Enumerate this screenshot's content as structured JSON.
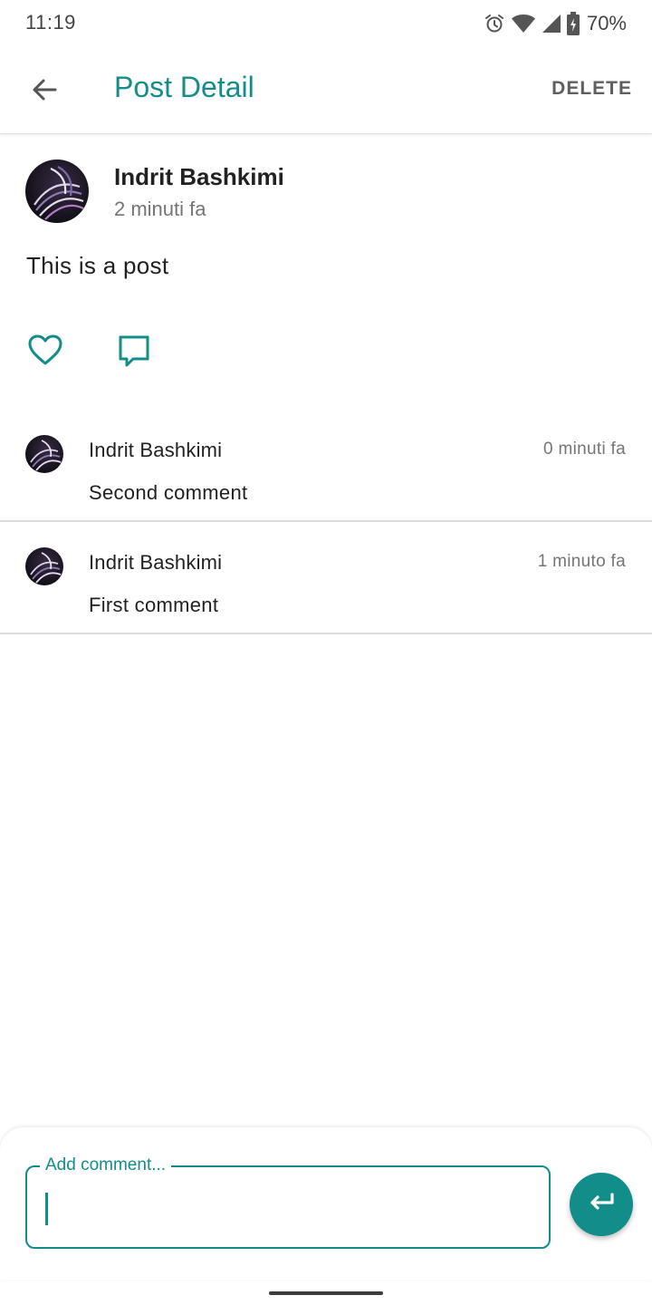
{
  "status_bar": {
    "time": "11:19",
    "battery_percent": "70%",
    "icons": [
      "alarm-icon",
      "wifi-icon",
      "signal-icon",
      "battery-charging-icon"
    ]
  },
  "app_bar": {
    "title": "Post Detail",
    "delete_label": "DELETE",
    "back_icon": "arrow-back-icon"
  },
  "post": {
    "author": "Indrit Bashkimi",
    "time": "2 minuti fa",
    "text": "This is a post",
    "like_icon": "heart-outline-icon",
    "comment_icon": "comment-outline-icon"
  },
  "comments": [
    {
      "author": "Indrit Bashkimi",
      "time": "0 minuti fa",
      "text": "Second comment"
    },
    {
      "author": "Indrit Bashkimi",
      "time": "1 minuto fa",
      "text": "First comment"
    }
  ],
  "composer": {
    "label": "Add comment...",
    "value": "",
    "send_icon": "keyboard-return-icon"
  },
  "colors": {
    "accent": "#138d8a",
    "text_primary": "#212121",
    "text_secondary": "#757575",
    "divider": "#dcdcdc"
  }
}
